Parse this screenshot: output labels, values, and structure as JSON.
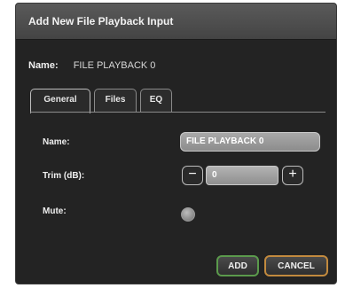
{
  "dialog": {
    "title": "Add New File Playback Input",
    "name_label": "Name:",
    "name_value": "FILE PLAYBACK 0"
  },
  "tabs": [
    {
      "label": "General",
      "active": true
    },
    {
      "label": "Files",
      "active": false
    },
    {
      "label": "EQ",
      "active": false
    }
  ],
  "form": {
    "name_label": "Name:",
    "name_value": "FILE PLAYBACK 0",
    "trim_label": "Trim (dB):",
    "trim_value": "0",
    "trim_minus": "−",
    "trim_plus": "+",
    "mute_label": "Mute:"
  },
  "buttons": {
    "add": "ADD",
    "cancel": "CANCEL"
  },
  "colors": {
    "add_border": "#5b9a4c",
    "cancel_border": "#c28a3e"
  }
}
